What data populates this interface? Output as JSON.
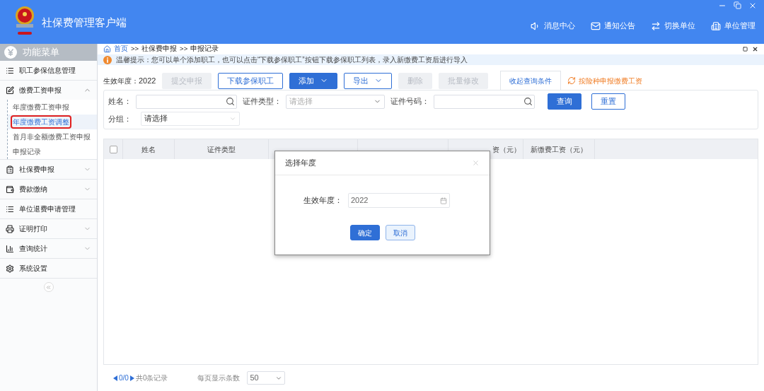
{
  "window": {
    "title": "社保费管理客户端"
  },
  "header_actions": [
    {
      "label": "消息中心",
      "kind": "speaker"
    },
    {
      "label": "通知公告",
      "kind": "mail"
    },
    {
      "label": "切换单位",
      "kind": "swap"
    },
    {
      "label": "单位管理",
      "kind": "building"
    }
  ],
  "sidebar": {
    "title": "功能菜单",
    "items": [
      {
        "label": "职工参保信息管理",
        "kind": "list",
        "expandable": false
      },
      {
        "label": "缴费工资申报",
        "kind": "edit",
        "expandable": true,
        "expanded": true,
        "children": [
          {
            "label": "年度缴费工资申报",
            "selected": false
          },
          {
            "label": "年度缴费工资调整",
            "selected": true
          },
          {
            "label": "首月非全额缴费工资申报",
            "selected": false
          },
          {
            "label": "申报记录",
            "selected": false
          }
        ]
      },
      {
        "label": "社保费申报",
        "kind": "clipboard",
        "expandable": true,
        "expanded": false
      },
      {
        "label": "费款缴纳",
        "kind": "wallet",
        "expandable": true,
        "expanded": false
      },
      {
        "label": "单位退费申请管理",
        "kind": "list",
        "expandable": false
      },
      {
        "label": "证明打印",
        "kind": "print",
        "expandable": true,
        "expanded": false
      },
      {
        "label": "查询统计",
        "kind": "chart",
        "expandable": true,
        "expanded": false
      },
      {
        "label": "系统设置",
        "kind": "gear",
        "expandable": false
      }
    ]
  },
  "breadcrumb": {
    "separator": ">>",
    "items": [
      "首页",
      "社保费申报",
      "申报记录"
    ]
  },
  "tip": "温馨提示：您可以单个添加职工，也可以点击“下载参保职工”按钮下载参保职工列表，录入新缴费工资后进行导入",
  "toolbar": {
    "year_label": "生效年度：",
    "year": "2022",
    "buttons": [
      {
        "label": "提交申报",
        "kind": "plain",
        "disabled": true
      },
      {
        "label": "下载参保职工",
        "kind": "plain",
        "disabled": false
      },
      {
        "label": "添加",
        "kind": "primary-menu",
        "disabled": false
      },
      {
        "label": "导出",
        "kind": "menu",
        "disabled": false
      },
      {
        "label": "删除",
        "kind": "plain",
        "disabled": true
      },
      {
        "label": "批量修改",
        "kind": "plain",
        "disabled": true
      }
    ],
    "tab": {
      "label": "收起查询条件",
      "selected": true
    },
    "link": "按险种申报缴费工资"
  },
  "filters": [
    {
      "label": "姓名：",
      "kind": "search"
    },
    {
      "label": "证件类型：",
      "kind": "select",
      "placeholder": "请选择"
    },
    {
      "label": "证件号码：",
      "kind": "search"
    }
  ],
  "filter_buttons": [
    {
      "label": "查询",
      "kind": "primary"
    },
    {
      "label": "重置",
      "kind": "plain"
    }
  ],
  "group_filter": {
    "label": "分组：",
    "value": "请选择"
  },
  "table": {
    "checked": false,
    "columns": [
      {
        "kind": "text",
        "label": "姓名"
      },
      {
        "kind": "text",
        "label": "证件类型"
      },
      {
        "kind": "covered"
      },
      {
        "kind": "covered"
      },
      {
        "kind": "text",
        "label": "资（元）"
      },
      {
        "kind": "text",
        "label": "新缴费工资（元）"
      }
    ]
  },
  "pagination": {
    "pages": "0/0",
    "total": "共0条记录",
    "page_size_label": "每页显示条数",
    "page_size": "50"
  },
  "dialog": {
    "title": "选择年度",
    "field_label": "生效年度：",
    "value": "2022",
    "buttons": [
      {
        "label": "确定",
        "kind": "primary"
      },
      {
        "label": "取消",
        "kind": "plain"
      }
    ]
  }
}
